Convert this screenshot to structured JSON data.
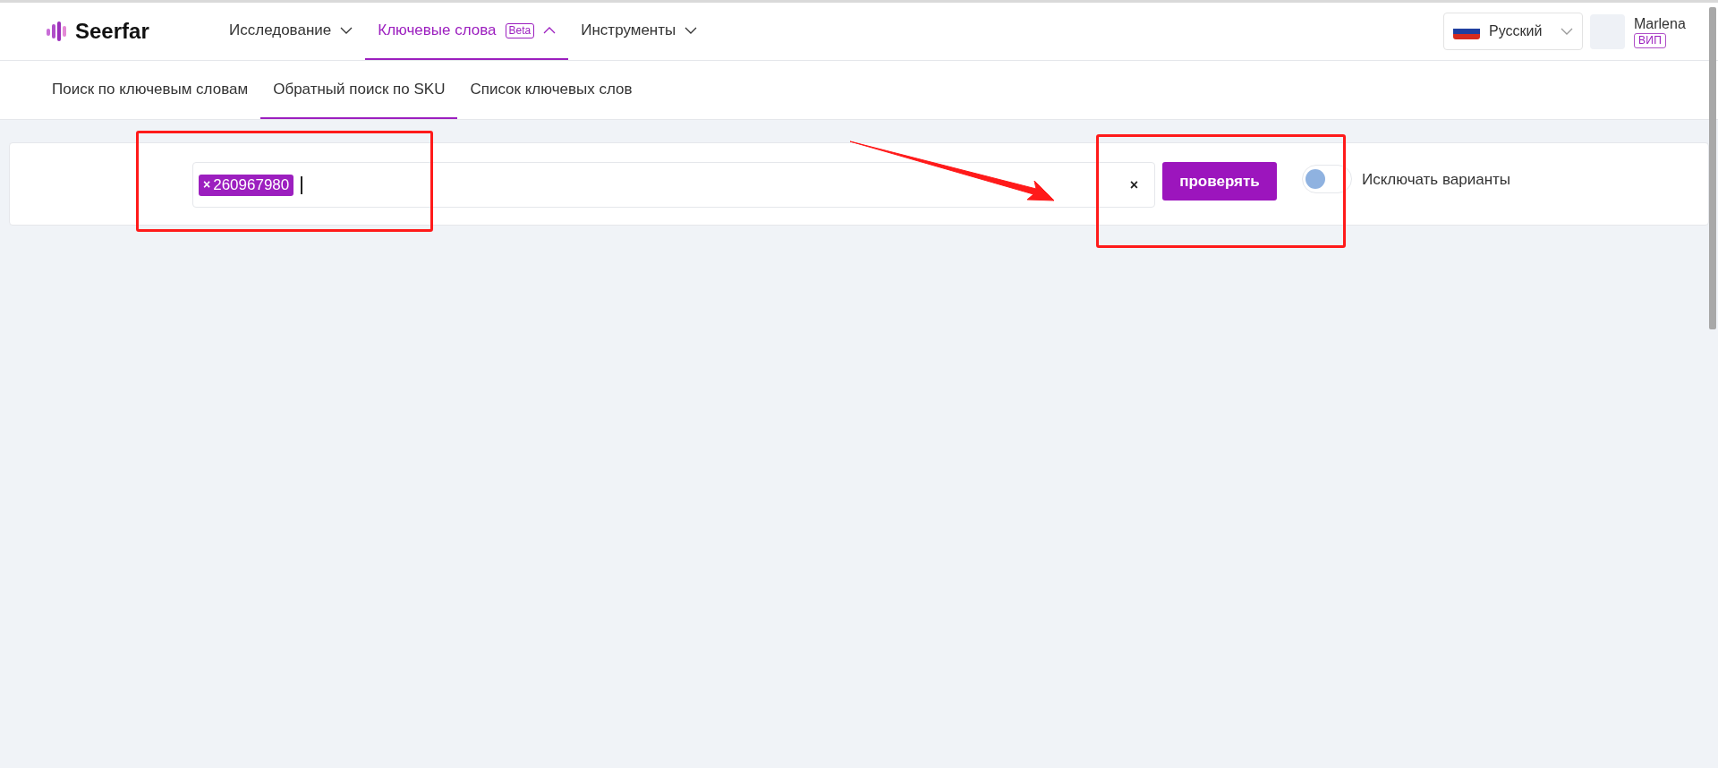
{
  "logo": {
    "text": "Seerfar"
  },
  "nav": [
    {
      "label": "Исследование",
      "selected": false,
      "expanded": false
    },
    {
      "label": "Ключевые слова",
      "badge": "Beta",
      "selected": true,
      "expanded": true
    },
    {
      "label": "Инструменты",
      "selected": false,
      "expanded": false
    }
  ],
  "language": {
    "label": "Русский"
  },
  "user": {
    "name": "Marlena",
    "badge": "ВИП"
  },
  "subtabs": [
    {
      "label": "Поиск по ключевым словам",
      "selected": false
    },
    {
      "label": "Обратный поиск по SKU",
      "selected": true
    },
    {
      "label": "Список ключевых слов",
      "selected": false
    }
  ],
  "search": {
    "tags": [
      {
        "remove": "×",
        "value": "260967980"
      }
    ],
    "clear": "×",
    "button": "проверять",
    "toggle": {
      "label": "Исключать варианты",
      "on": false
    }
  }
}
